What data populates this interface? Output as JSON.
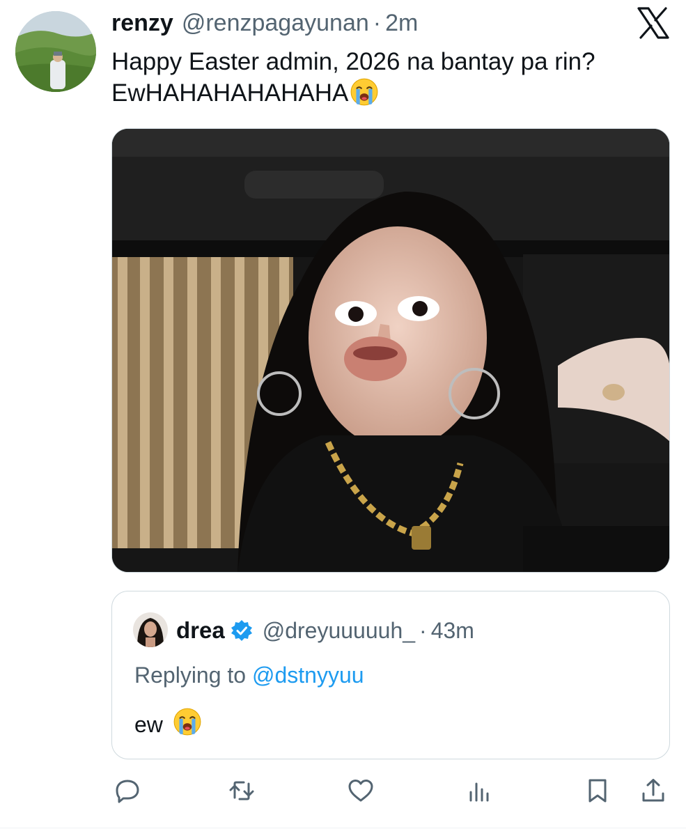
{
  "tweet": {
    "author_name": "renzy",
    "author_handle": "@renzpagayunan",
    "separator": "·",
    "time": "2m",
    "text_line1": "Happy Easter admin, 2026 na bantay pa rin?",
    "text_line2": "EwHAHAHAHAHAHA",
    "text_emoji": "loudly-crying-face-emoji",
    "platform_icon": "x-logo-icon",
    "media_description_icon": "photo"
  },
  "quoted_tweet": {
    "author_name": "drea",
    "verified_icon": "verified-badge-icon",
    "author_handle": "@dreyuuuuuh_",
    "separator": "·",
    "time": "43m",
    "replying_prefix": "Replying to",
    "replying_to": "@dstnyyuu",
    "text": "ew",
    "text_emoji": "loudly-crying-face-emoji"
  },
  "actions": [
    {
      "name": "reply",
      "icon": "reply-icon"
    },
    {
      "name": "retweet",
      "icon": "retweet-icon"
    },
    {
      "name": "like",
      "icon": "heart-icon"
    },
    {
      "name": "views",
      "icon": "analytics-icon"
    },
    {
      "name": "bookmark",
      "icon": "bookmark-icon"
    },
    {
      "name": "share",
      "icon": "share-icon"
    }
  ],
  "colors": {
    "text_primary": "#0f1419",
    "text_secondary": "#536471",
    "accent": "#1d9bf0",
    "border": "#cfd9de"
  }
}
